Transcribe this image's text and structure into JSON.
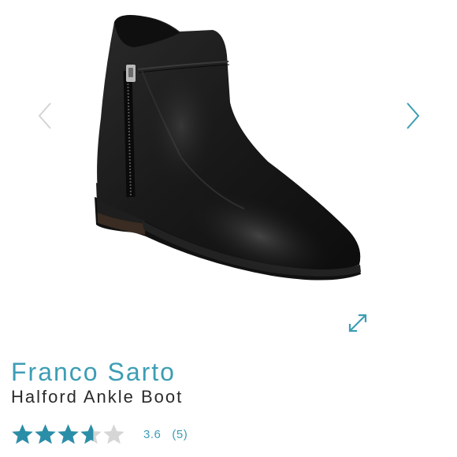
{
  "product": {
    "brand": "Franco Sarto",
    "name": "Halford Ankle Boot"
  },
  "rating": {
    "value": "3.6",
    "count": "(5)",
    "stars_filled_fraction": 0.72,
    "star_count": 5
  },
  "gallery": {
    "prev_icon": "chevron-left-icon",
    "next_icon": "chevron-right-icon",
    "expand_icon": "expand-icon"
  },
  "colors": {
    "accent": "#3d9db4",
    "star_filled": "#2b8ea8",
    "star_empty": "#d6d6d6",
    "text": "#2b2b2b",
    "chevron_prev": "#d4d4d4",
    "chevron_next": "#3d9db4"
  }
}
